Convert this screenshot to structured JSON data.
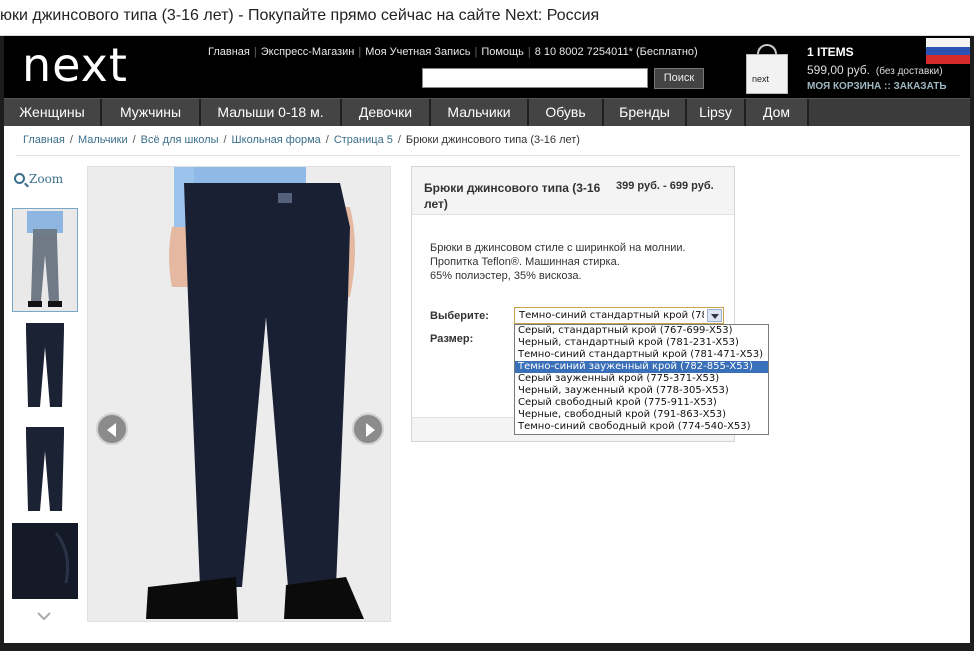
{
  "browser": {
    "title": "юки джинсового типа (3-16 лет) - Покупайте прямо сейчас на сайте Next: Россия"
  },
  "header": {
    "logo": "next",
    "toplinks": [
      "Главная",
      "Экспресс-Магазин",
      "Моя Учетная Запись",
      "Помощь",
      "8 10 8002 7254011* (Бесплатно)"
    ],
    "search": {
      "value": "",
      "button": "Поиск"
    },
    "bag_label": "next",
    "cart": {
      "items": "1 ITEMS",
      "price": "599,00 руб.",
      "price_note": "(без доставки)",
      "my_cart": "МОЯ КОРЗИНА",
      "separator": "::",
      "checkout": "ЗАКАЗАТЬ"
    },
    "flag_colors": [
      "#f4f4f4",
      "#2c52b2",
      "#d52b2b"
    ]
  },
  "nav": {
    "items": [
      "Женщины",
      "Мужчины",
      "Малыши 0-18 м.",
      "Девочки",
      "Мальчики",
      "Обувь",
      "Бренды",
      "Lipsy",
      "Дом"
    ]
  },
  "breadcrumb": {
    "links": [
      "Главная",
      "Мальчики",
      "Всё для школы",
      "Школьная форма",
      "Страница 5"
    ],
    "current": "Брюки джинсового типа (3-16 лет)"
  },
  "gallery": {
    "zoom_label": "Zoom"
  },
  "product": {
    "title": "Брюки джинсового типа (3-16 лет)",
    "price": "399 руб. - 699 руб.",
    "description": [
      "Брюки в джинсовом стиле с ширинкой на молнии.",
      "Пропитка Teflon®. Машинная стирка.",
      "65% полиэстер, 35% вискоза."
    ],
    "choose_label": "Выберите:",
    "size_label": "Размер:",
    "selected_option": "Темно-синий стандартный крой (78",
    "options": [
      "Серый, стандартный крой (767-699-X53)",
      "Черный, стандартный крой (781-231-X53)",
      "Темно-синий стандартный крой (781-471-X53)",
      "Темно-синий зауженный крой (782-855-X53)",
      "Серый зауженный крой (775-371-X53)",
      "Черный, зауженный крой (778-305-X53)",
      "Серый свободный крой (775-911-X53)",
      "Черные, свободный крой (791-863-X53)",
      "Темно-синий свободный крой (774-540-X53)"
    ],
    "highlighted_option_index": 3
  },
  "colors": {
    "accent_link": "#3b6f8c",
    "highlight": "#3a6fb9",
    "nav_bg": "#444444",
    "header_bg": "#000000"
  }
}
